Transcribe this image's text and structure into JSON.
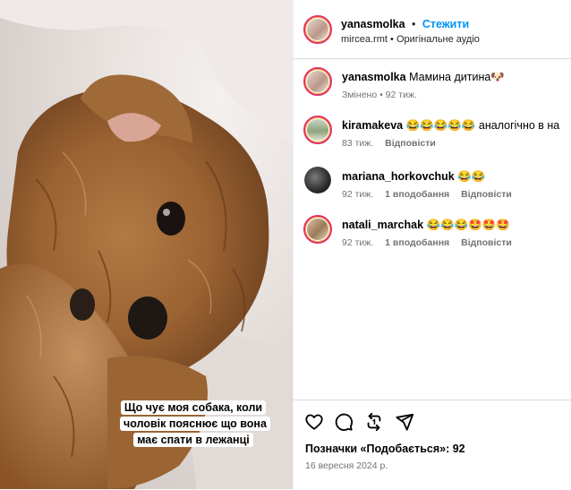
{
  "post": {
    "author": "yanasmolka",
    "follow_label": "Стежити",
    "separator": "•",
    "audio_user": "mircea.rmt",
    "audio_sep": "•",
    "audio_label": "Оригінальне аудіо",
    "media_caption": "Що чує моя собака, коли чоловік пояснює що вона має спати в лежанці"
  },
  "comments": [
    {
      "user": "yanasmolka",
      "text": "Мамина дитина🐶",
      "meta_time": "Змінено • 92 тиж."
    },
    {
      "user": "kiramakeva",
      "text": "😂😂😂😂😂 аналогічно в на",
      "meta_time": "83 тиж.",
      "reply": "Відповісти"
    },
    {
      "user": "mariana_horkovchuk",
      "text": "😂😂",
      "meta_time": "92 тиж.",
      "likes": "1 вподобання",
      "reply": "Відповісти"
    },
    {
      "user": "natali_marchak",
      "text": "😂😂😂🤩🤩🤩",
      "meta_time": "92 тиж.",
      "likes": "1 вподобання",
      "reply": "Відповісти"
    }
  ],
  "footer": {
    "likes_text": "Позначки «Подобається»: 92",
    "date": "16 вересня 2024 р."
  },
  "icons": [
    "heart-icon",
    "comment-icon",
    "repost-icon",
    "share-icon"
  ],
  "colors": {
    "follow": "#0095f6",
    "meta": "#737373",
    "ring": "#e1306c"
  }
}
